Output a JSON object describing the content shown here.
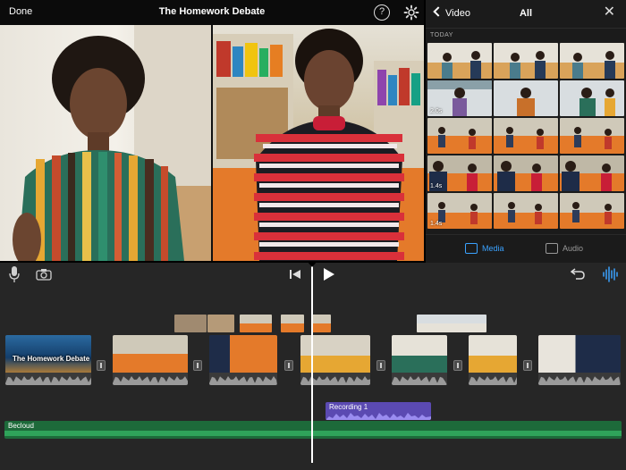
{
  "topbar": {
    "done_label": "Done",
    "project_title": "The Homework Debate",
    "help_glyph": "?"
  },
  "browser": {
    "back_label": "Video",
    "title": "All",
    "close_glyph": "✕",
    "section_label": "TODAY",
    "durations": [
      "2.0s",
      "1.4s",
      "1.4s"
    ],
    "tabs": [
      {
        "label": "Media",
        "icon": "film-icon",
        "selected": true
      },
      {
        "label": "Audio",
        "icon": "music-note-icon",
        "selected": false
      }
    ]
  },
  "timeline": {
    "title_clip_text": "The Homework Debate",
    "recording_label": "Recording 1",
    "music_label": "Becloud"
  },
  "colors": {
    "accent": "#3aa2ff",
    "recording": "#5b4ab2",
    "music_track": "#1d6a3a",
    "timeline_bg": "#262626"
  }
}
